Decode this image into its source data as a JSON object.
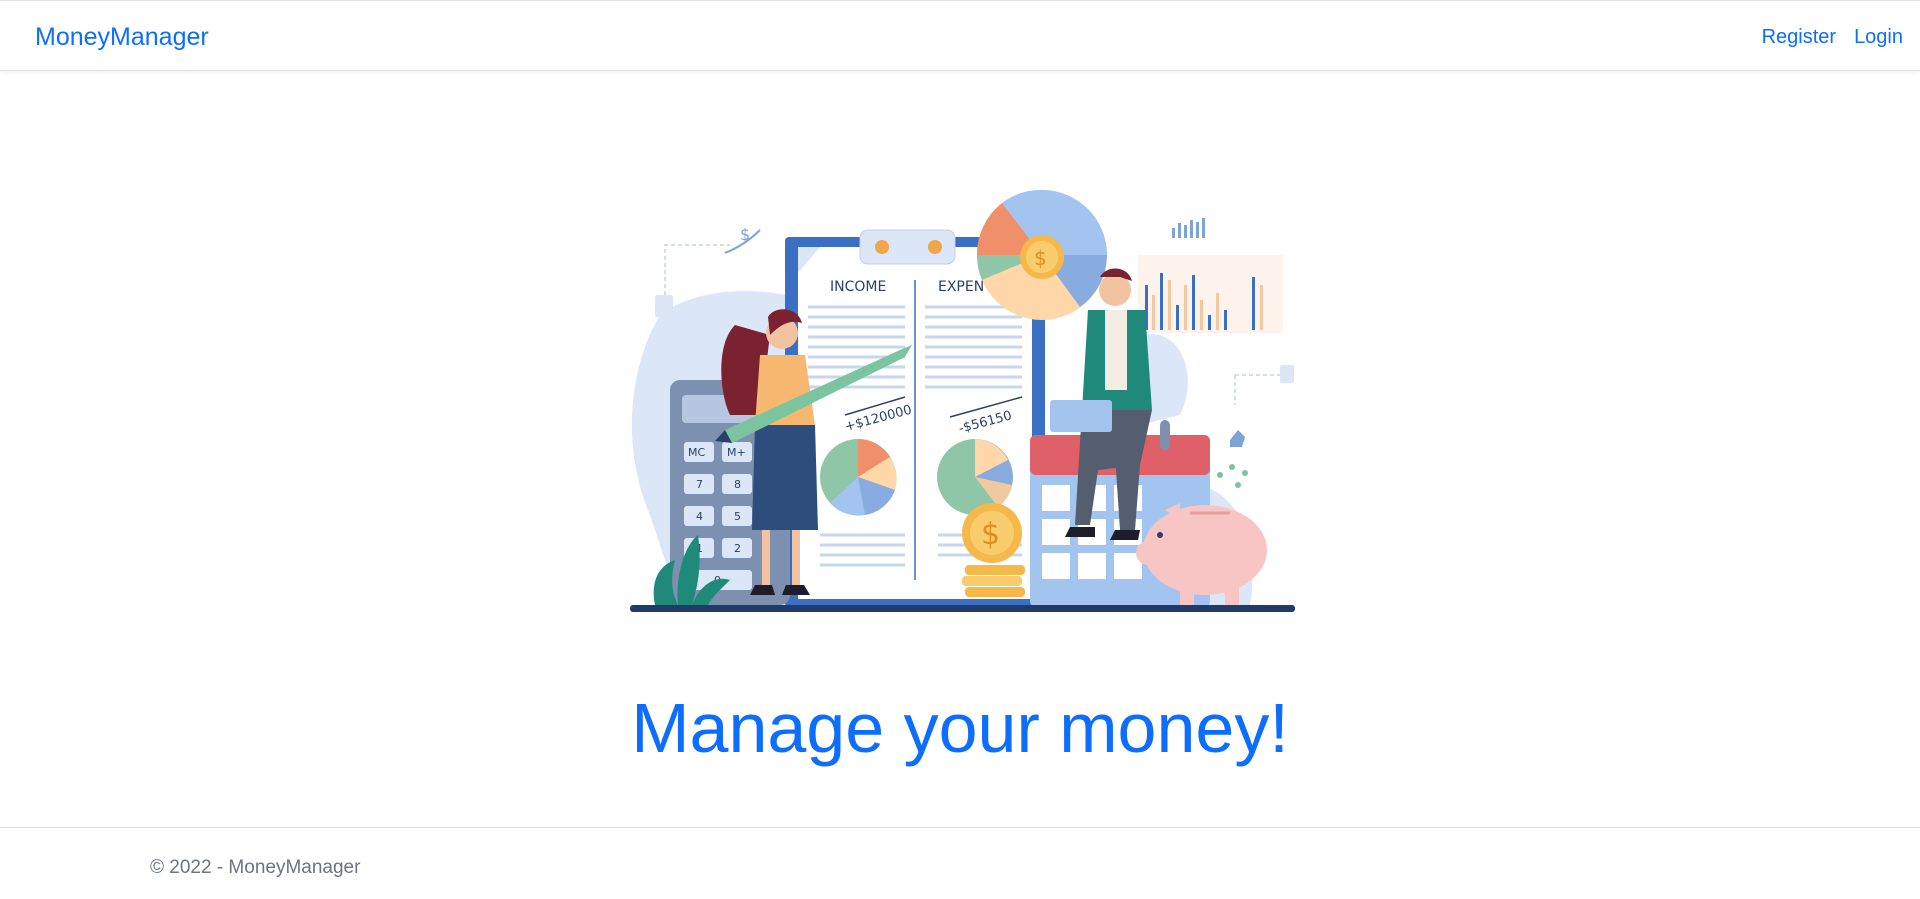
{
  "navbar": {
    "brand": "MoneyManager",
    "links": {
      "register": "Register",
      "login": "Login"
    }
  },
  "hero": {
    "illustration": {
      "income_heading": "INCOME",
      "expense_heading": "EXPEN",
      "income_amount": "+$120000",
      "expense_amount": "-$56150",
      "calculator_keys": [
        "MC",
        "M+",
        "7",
        "8",
        "4",
        "5",
        "1",
        "2",
        "0"
      ],
      "currency_symbol": "$"
    },
    "headline": "Manage your money!"
  },
  "footer": {
    "copyright": "© 2022 - MoneyManager"
  },
  "colors": {
    "primary": "#0d6efd",
    "muted": "#6c757d",
    "border": "#dee2e6"
  }
}
